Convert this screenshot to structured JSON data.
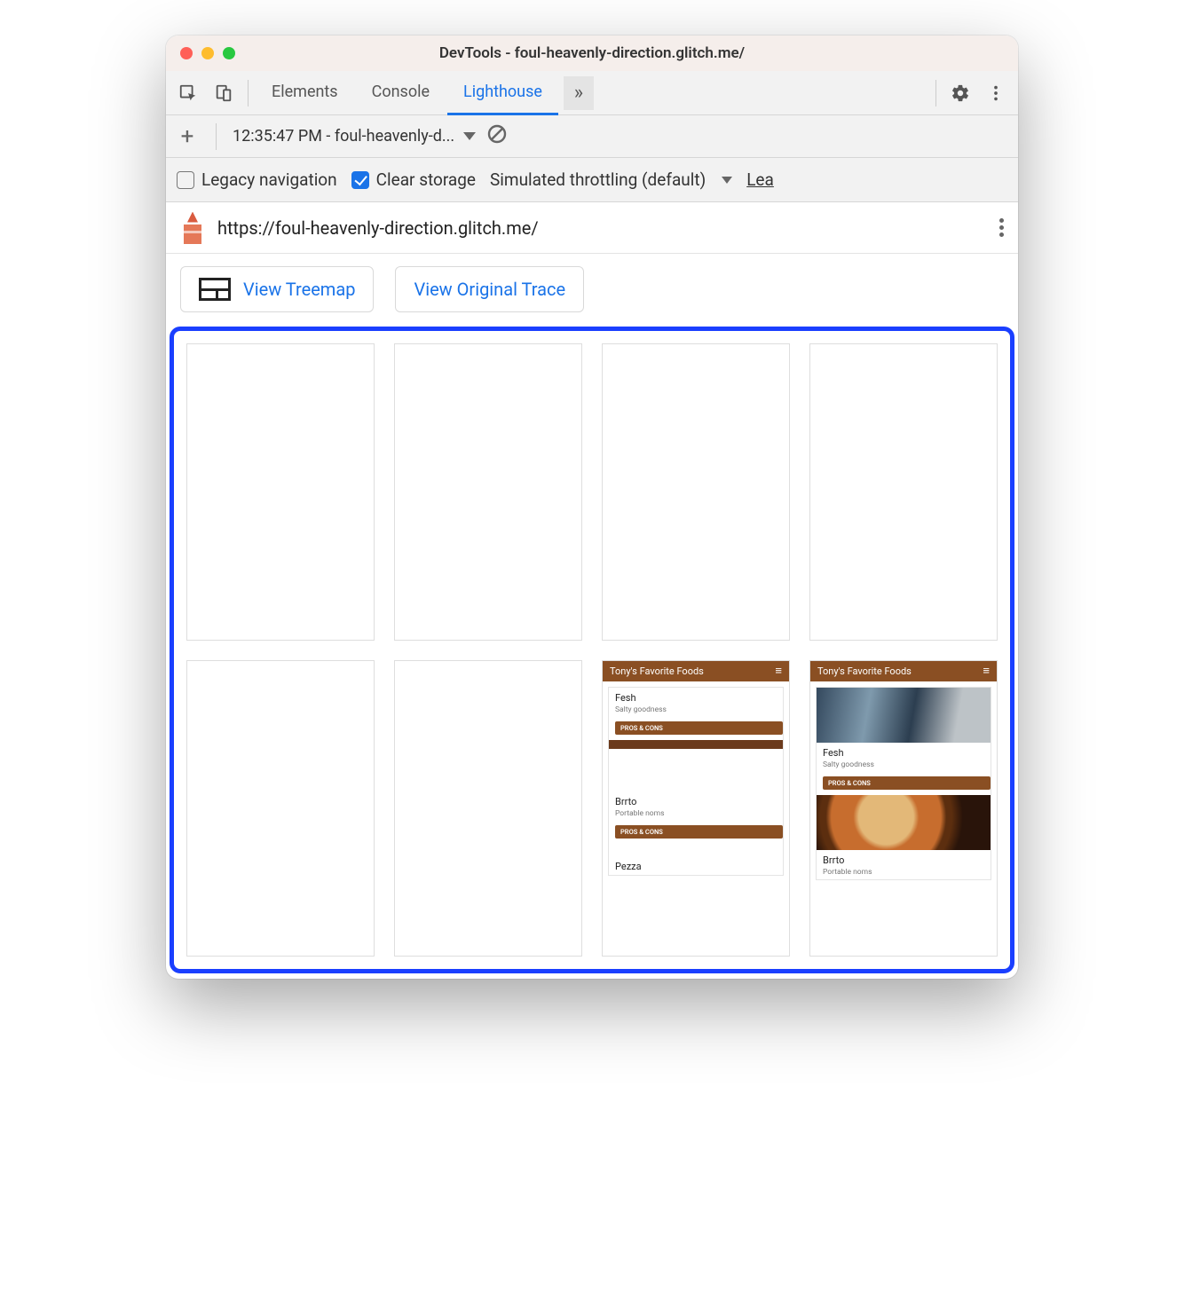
{
  "window": {
    "title": "DevTools - foul-heavenly-direction.glitch.me/"
  },
  "toolbar": {
    "tabs": {
      "elements": "Elements",
      "console": "Console",
      "lighthouse": "Lighthouse"
    },
    "overflow_glyph": "»"
  },
  "picker": {
    "plus": "+",
    "label": "12:35:47 PM - foul-heavenly-d..."
  },
  "options": {
    "legacy": {
      "label": "Legacy navigation",
      "checked": false
    },
    "clear": {
      "label": "Clear storage",
      "checked": true
    },
    "throttle": "Simulated throttling (default)",
    "learn": "Lea"
  },
  "url": {
    "value": "https://foul-heavenly-direction.glitch.me/"
  },
  "viewbuttons": {
    "treemap": "View Treemap",
    "trace": "View Original Trace"
  },
  "mini": {
    "header": "Tony's Favorite Foods",
    "hamburger": "≡",
    "item1": {
      "title": "Fesh",
      "sub": "Salty goodness",
      "btn": "PROS & CONS"
    },
    "item2": {
      "title": "Brrto",
      "sub": "Portable noms",
      "btn": "PROS & CONS"
    },
    "item3": {
      "title": "Pezza"
    }
  }
}
